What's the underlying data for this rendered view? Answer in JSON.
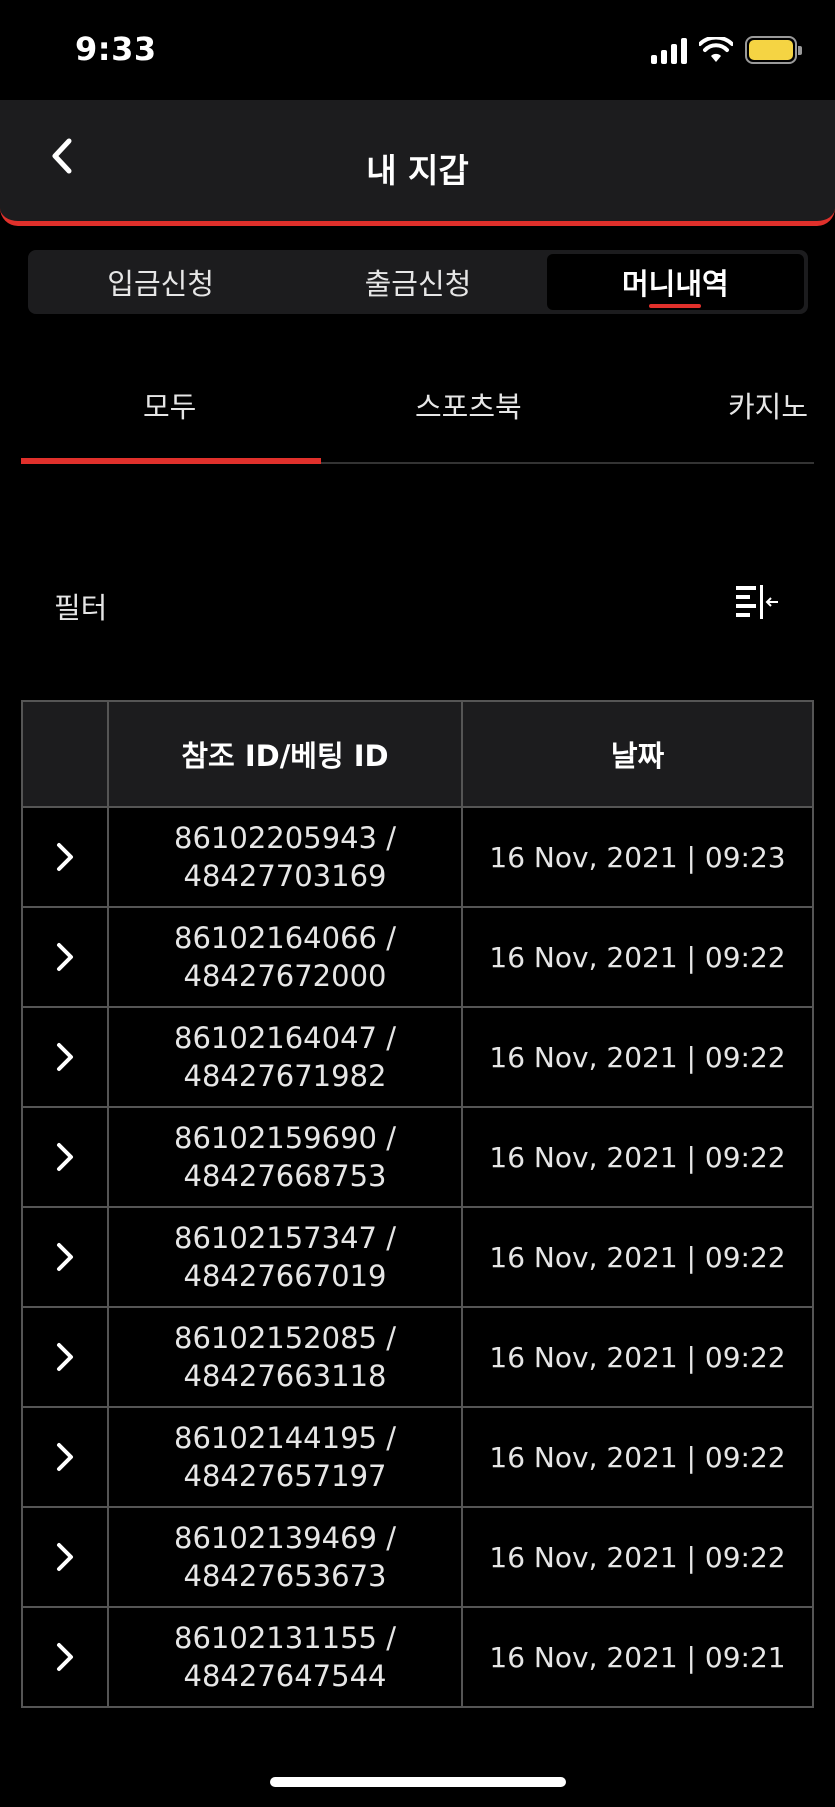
{
  "status": {
    "time": "9:33"
  },
  "header": {
    "title": "내 지갑"
  },
  "segments": [
    {
      "label": "입금신청"
    },
    {
      "label": "출금신청"
    },
    {
      "label": "머니내역"
    }
  ],
  "categories": [
    {
      "label": "모두"
    },
    {
      "label": "스포츠북"
    },
    {
      "label": "카지노"
    }
  ],
  "filter": {
    "label": "필터"
  },
  "table": {
    "headers": {
      "id": "참조 ID/베팅 ID",
      "date": "날짜"
    },
    "rows": [
      {
        "ref_id": "86102205943 /",
        "bet_id": "48427703169",
        "date": "16 Nov, 2021 | 09:23"
      },
      {
        "ref_id": "86102164066 /",
        "bet_id": "48427672000",
        "date": "16 Nov, 2021 | 09:22"
      },
      {
        "ref_id": "86102164047 /",
        "bet_id": "48427671982",
        "date": "16 Nov, 2021 | 09:22"
      },
      {
        "ref_id": "86102159690 /",
        "bet_id": "48427668753",
        "date": "16 Nov, 2021 | 09:22"
      },
      {
        "ref_id": "86102157347 /",
        "bet_id": "48427667019",
        "date": "16 Nov, 2021 | 09:22"
      },
      {
        "ref_id": "86102152085 /",
        "bet_id": "48427663118",
        "date": "16 Nov, 2021 | 09:22"
      },
      {
        "ref_id": "86102144195 /",
        "bet_id": "48427657197",
        "date": "16 Nov, 2021 | 09:22"
      },
      {
        "ref_id": "86102139469 /",
        "bet_id": "48427653673",
        "date": "16 Nov, 2021 | 09:22"
      },
      {
        "ref_id": "86102131155 /",
        "bet_id": "48427647544",
        "date": "16 Nov, 2021 | 09:21"
      }
    ]
  },
  "colors": {
    "accent": "#e0302b",
    "background": "#000000",
    "surface": "#1c1c1e",
    "battery": "#f5d443"
  }
}
